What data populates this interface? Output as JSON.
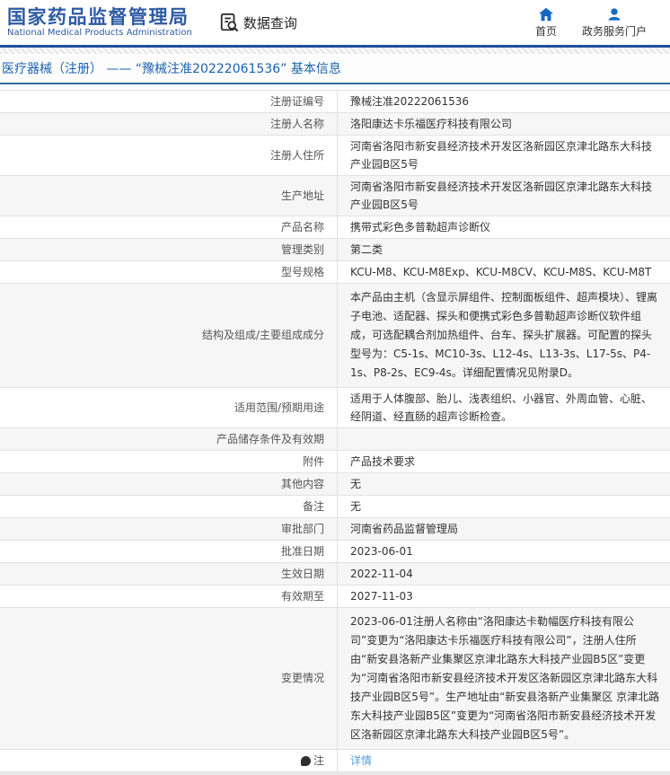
{
  "header": {
    "org_name_zh": "国家药品监督管理局",
    "org_name_en": "National Medical Products Administration",
    "data_query_label": "数据查询",
    "home_label": "首页",
    "portal_label": "政务服务门户"
  },
  "breadcrumb": {
    "text": "医疗器械（注册） —— “豫械注准20222061536” 基本信息"
  },
  "icons": {
    "data_query": "document-magnifier-icon",
    "home": "house-icon",
    "portal": "person-icon",
    "note": "comment-dot-icon"
  },
  "colors": {
    "brand_blue": "#2d5ba3",
    "icon_blue": "#1668c7",
    "breadcrumb_blue": "#1b61ae",
    "link_blue": "#4f9fe0",
    "rule_blue": "#1f4f9f"
  },
  "table": {
    "rows": [
      {
        "label": "注册证编号",
        "value": "豫械注准20222061536"
      },
      {
        "label": "注册人名称",
        "value": "洛阳康达卡乐福医疗科技有限公司"
      },
      {
        "label": "注册人住所",
        "value": "河南省洛阳市新安县经济技术开发区洛新园区京津北路东大科技产业园B区5号"
      },
      {
        "label": "生产地址",
        "value": "河南省洛阳市新安县经济技术开发区洛新园区京津北路东大科技产业园B区5号"
      },
      {
        "label": "产品名称",
        "value": "携带式彩色多普勒超声诊断仪"
      },
      {
        "label": "管理类别",
        "value": "第二类"
      },
      {
        "label": "型号规格",
        "value": "KCU-M8、KCU-M8Exp、KCU-M8CV、KCU-M8S、KCU-M8T"
      },
      {
        "label": "结构及组成/主要组成成分",
        "value": "本产品由主机（含显示屏组件、控制面板组件、超声模块）、锂离子电池、适配器、探头和便携式彩色多普勒超声诊断仪软件组成，可选配耦合剂加热组件、台车、探头扩展器。可配置的探头型号为：C5-1s、MC10-3s、L12-4s、L13-3s、L17-5s、P4-1s、P8-2s、EC9-4s。详细配置情况见附录D。"
      },
      {
        "label": "适用范围/预期用途",
        "value": "适用于人体腹部、胎儿、浅表组织、小器官、外周血管、心脏、经阴道、经直肠的超声诊断检查。"
      },
      {
        "label": "产品储存条件及有效期",
        "value": ""
      },
      {
        "label": "附件",
        "value": "产品技术要求"
      },
      {
        "label": "其他内容",
        "value": "无"
      },
      {
        "label": "备注",
        "value": "无"
      },
      {
        "label": "审批部门",
        "value": "河南省药品监督管理局"
      },
      {
        "label": "批准日期",
        "value": "2023-06-01"
      },
      {
        "label": "生效日期",
        "value": "2022-11-04"
      },
      {
        "label": "有效期至",
        "value": "2027-11-03"
      },
      {
        "label": "变更情况",
        "value": "2023-06-01注册人名称由“洛阳康达卡勒幅医疗科技有限公司”变更为“洛阳康达卡乐福医疗科技有限公司”，注册人住所由“新安县洛新产业集聚区京津北路东大科技产业园B5区”变更为“河南省洛阳市新安县经济技术开发区洛新园区京津北路东大科技产业园B区5号”。生产地址由“新安县洛新产业集聚区 京津北路东大科技产业园B5区”变更为“河南省洛阳市新安县经济技术开发区洛新园区京津北路东大科技产业园B区5号”。"
      },
      {
        "label": "注",
        "value": "详情"
      }
    ]
  }
}
